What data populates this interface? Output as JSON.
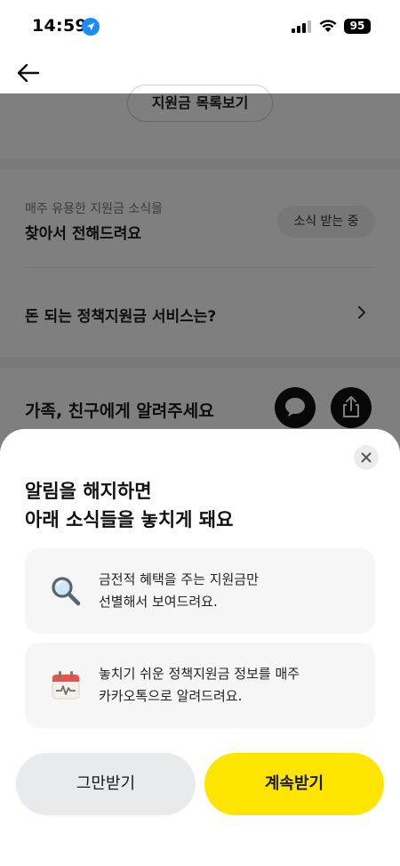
{
  "status_bar": {
    "time": "14:59",
    "battery": "95",
    "icons": [
      "location-arrow-icon",
      "signal-icon",
      "wifi-icon",
      "battery-icon"
    ]
  },
  "header": {
    "back_icon": "back-arrow-icon"
  },
  "background": {
    "preview_button": "지원금 목록보기",
    "subscription": {
      "caption": "매주 유용한 지원금 소식을",
      "title": "찾아서 전해드려요",
      "badge": "소식 받는 중"
    },
    "policy_row": {
      "label": "돈 되는 정책지원금 서비스는?"
    },
    "share_row": {
      "label": "가족, 친구에게 알려주세요",
      "icons": [
        "talk-bubble-icon",
        "share-upload-icon"
      ]
    }
  },
  "sheet": {
    "title_line1": "알림을 해지하면",
    "title_line2": "아래 소식들을 놓치게 돼요",
    "cards": [
      {
        "icon": "magnifier-icon",
        "line1": "금전적 혜택을 주는 지원금만",
        "line2": "선별해서 보여드려요."
      },
      {
        "icon": "calendar-icon",
        "line1": "놓치기 쉬운 정책지원금 정보를 매주",
        "line2": "카카오톡으로 알려드려요."
      }
    ],
    "stop_label": "그만받기",
    "continue_label": "계속받기"
  },
  "colors": {
    "accent_yellow": "#fee500",
    "secondary_button": "#e8eaed",
    "card_bg": "#f6f6f6",
    "overlay": "rgba(0,0,0,0.5)"
  }
}
